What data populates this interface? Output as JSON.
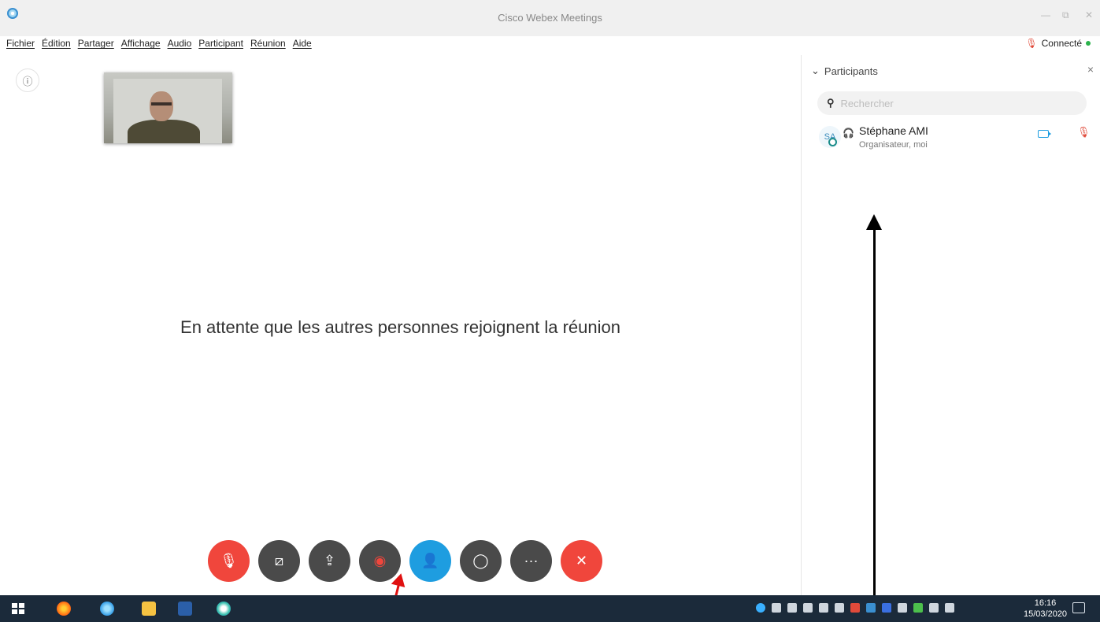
{
  "window": {
    "title": "Cisco Webex Meetings",
    "controls": {
      "minimize": "—",
      "restore": "⧉",
      "close": "✕"
    }
  },
  "menu": [
    "Fichier",
    "Édition",
    "Partager",
    "Affichage",
    "Audio",
    "Participant",
    "Réunion",
    "Aide"
  ],
  "status": {
    "label": "Connecté",
    "color": "#2bb24c"
  },
  "stage": {
    "waiting_message": "En attente que les autres personnes rejoignent la réunion",
    "info_icon": "info-icon"
  },
  "controls": [
    {
      "name": "mute-button",
      "icon": "mic-off-icon",
      "glyph": "🎙",
      "style": "red"
    },
    {
      "name": "video-button",
      "icon": "video-off-icon",
      "glyph": "⧄",
      "style": "dark"
    },
    {
      "name": "share-button",
      "icon": "share-icon",
      "glyph": "⇪",
      "style": "dark"
    },
    {
      "name": "record-button",
      "icon": "record-icon",
      "glyph": "◉",
      "style": "dark"
    },
    {
      "name": "participants-button",
      "icon": "participants-icon",
      "glyph": "👤",
      "style": "blue"
    },
    {
      "name": "chat-button",
      "icon": "chat-icon",
      "glyph": "◯",
      "style": "dark"
    },
    {
      "name": "more-button",
      "icon": "more-icon",
      "glyph": "···",
      "style": "dark"
    },
    {
      "name": "leave-button",
      "icon": "close-icon",
      "glyph": "✕",
      "style": "red"
    }
  ],
  "panel": {
    "title": "Participants",
    "close": "×",
    "search_placeholder": "Rechercher",
    "participants": [
      {
        "initials": "SA",
        "name": "Stéphane AMI",
        "role": "Organisateur, moi"
      }
    ]
  },
  "taskbar": {
    "time": "16:16",
    "date": "15/03/2020"
  },
  "colors": {
    "accent": "#1e9de0",
    "danger": "#f0463c",
    "control_dark": "#4a4a4a"
  }
}
